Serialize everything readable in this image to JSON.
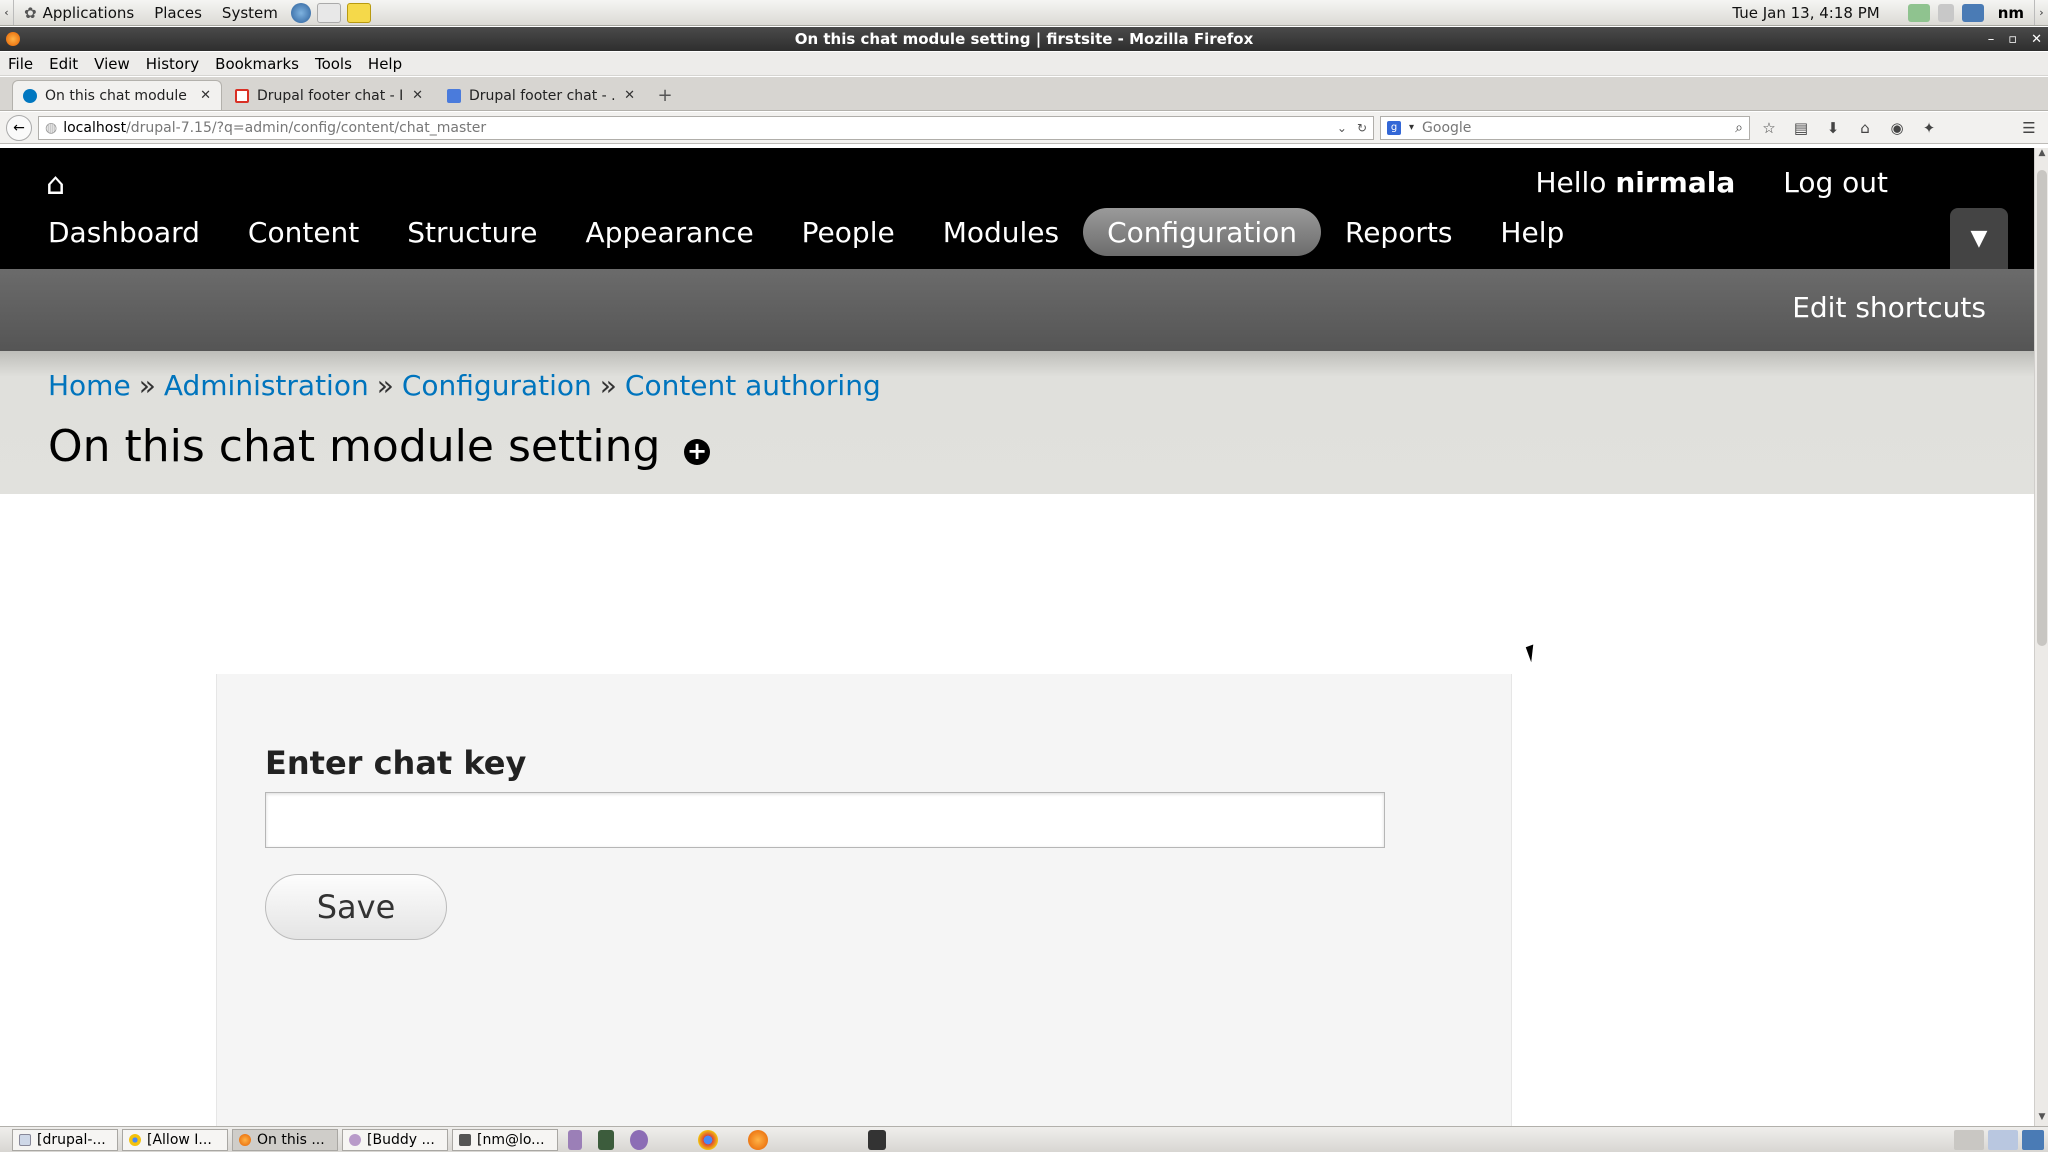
{
  "panel": {
    "applications": "Applications",
    "places": "Places",
    "system": "System",
    "clock": "Tue Jan 13,  4:18 PM",
    "user": "nm"
  },
  "window": {
    "title": "On this chat module setting | firstsite - Mozilla Firefox"
  },
  "menubar": {
    "items": [
      "File",
      "Edit",
      "View",
      "History",
      "Bookmarks",
      "Tools",
      "Help"
    ]
  },
  "tabs": [
    {
      "label": "On this chat module ...",
      "active": true
    },
    {
      "label": "Drupal footer chat - I...",
      "active": false
    },
    {
      "label": "Drupal footer chat - ...",
      "active": false
    }
  ],
  "navbar": {
    "url_host": "localhost",
    "url_path": "/drupal-7.15/?q=admin/config/content/chat_master",
    "search_placeholder": "Google"
  },
  "toolbar": {
    "hello_prefix": "Hello ",
    "username": "nirmala",
    "logout": "Log out",
    "menu": [
      "Dashboard",
      "Content",
      "Structure",
      "Appearance",
      "People",
      "Modules",
      "Configuration",
      "Reports",
      "Help"
    ],
    "active_item": "Configuration",
    "edit_shortcuts": "Edit shortcuts"
  },
  "breadcrumb": {
    "items": [
      "Home",
      "Administration",
      "Configuration",
      "Content authoring"
    ],
    "separator": "»"
  },
  "page": {
    "title": "On this chat module setting"
  },
  "form": {
    "field_label": "Enter chat key",
    "field_value": "",
    "save_label": "Save"
  },
  "taskbar": {
    "tasks": [
      "[drupal-...",
      "[Allow I...",
      "On this ...",
      "[Buddy ...",
      "[nm@lo..."
    ],
    "active_task": "On this ..."
  },
  "colors": {
    "link": "#0074bd",
    "toolbar_bg": "#000000",
    "active_menu": "#8a8a8a"
  }
}
